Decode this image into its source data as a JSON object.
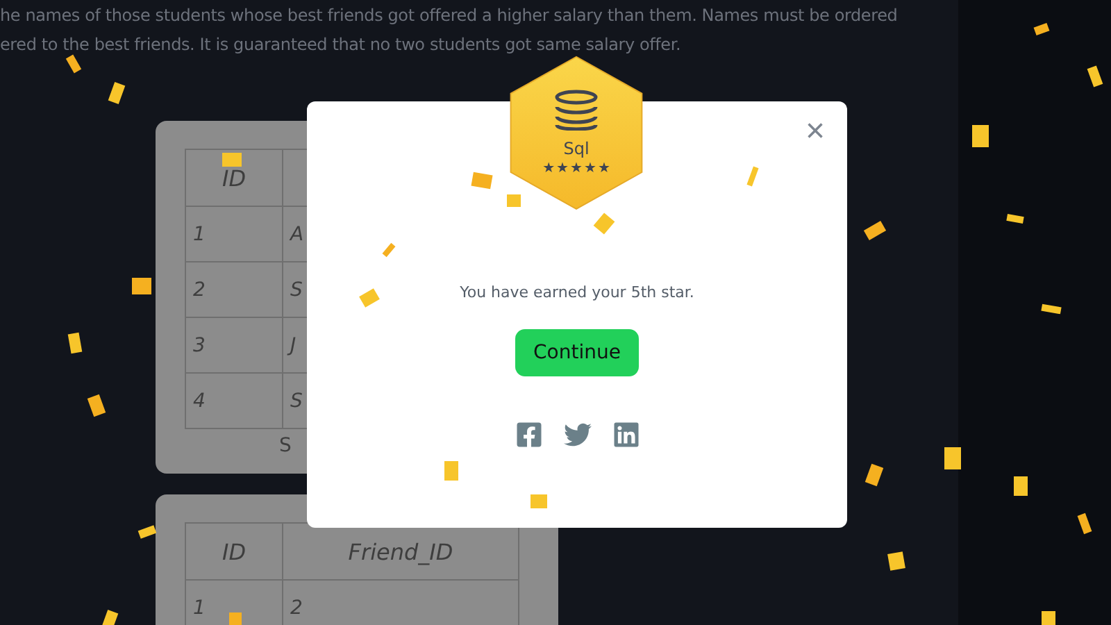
{
  "problem_text": [
    "he names of those students whose best friends got offered a higher salary than them. Names must be ordered",
    "ered to the best friends. It is guaranteed that no two students got same salary offer."
  ],
  "tables": [
    {
      "columns": [
        "ID",
        ""
      ],
      "rows": [
        [
          "1",
          "A"
        ],
        [
          "2",
          "S"
        ],
        [
          "3",
          "J"
        ],
        [
          "4",
          "S"
        ]
      ],
      "caption": "S"
    },
    {
      "columns": [
        "ID",
        "Friend_ID"
      ],
      "rows": [
        [
          "1",
          "2"
        ]
      ]
    }
  ],
  "modal": {
    "badge": {
      "label": "Sql",
      "stars": 5
    },
    "close": "×",
    "message": "You have earned your 5th star.",
    "button": "Continue",
    "share": [
      {
        "kind": "facebook"
      },
      {
        "kind": "twitter"
      },
      {
        "kind": "linkedin"
      }
    ]
  }
}
